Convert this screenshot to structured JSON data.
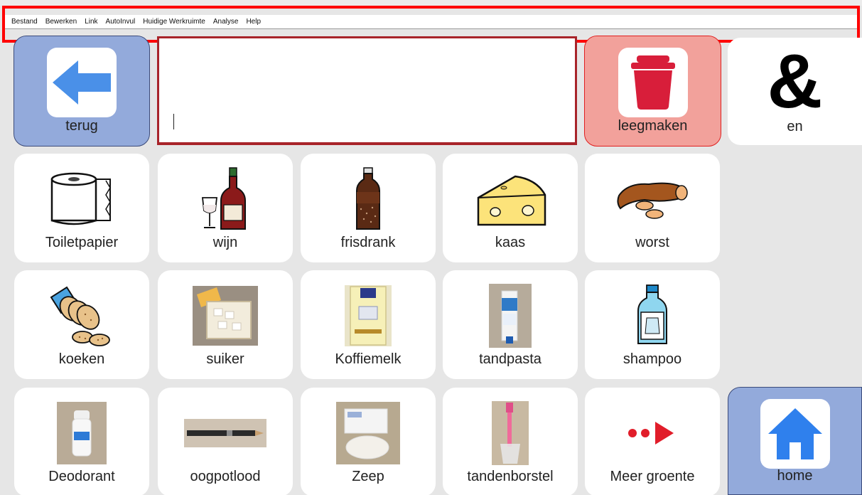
{
  "menu": {
    "items": [
      "Bestand",
      "Bewerken",
      "Link",
      "AutoInvul",
      "Huidige Werkruimte",
      "Analyse",
      "Help"
    ]
  },
  "toprow": {
    "back": {
      "label": "terug",
      "icon": "arrow-left-icon"
    },
    "clear": {
      "label": "leegmaken",
      "icon": "trash-icon"
    },
    "and": {
      "label": "en",
      "symbol": "&"
    }
  },
  "grid": {
    "row1": [
      {
        "label": "Toiletpapier",
        "icon": "toilet-paper-icon"
      },
      {
        "label": "wijn",
        "icon": "wine-icon"
      },
      {
        "label": "frisdrank",
        "icon": "soda-bottle-icon"
      },
      {
        "label": "kaas",
        "icon": "cheese-icon"
      },
      {
        "label": "worst",
        "icon": "sausage-icon"
      }
    ],
    "row2": [
      {
        "label": "koeken",
        "icon": "cookies-icon"
      },
      {
        "label": "suiker",
        "icon": "sugar-photo"
      },
      {
        "label": "Koffiemelk",
        "icon": "coffee-milk-photo"
      },
      {
        "label": "tandpasta",
        "icon": "toothpaste-photo"
      },
      {
        "label": "shampoo",
        "icon": "shampoo-icon"
      }
    ],
    "row3": [
      {
        "label": "Deodorant",
        "icon": "deodorant-photo"
      },
      {
        "label": "oogpotlood",
        "icon": "eye-pencil-photo"
      },
      {
        "label": "Zeep",
        "icon": "soap-photo"
      },
      {
        "label": "tandenborstel",
        "icon": "toothbrush-photo"
      },
      {
        "label": "Meer groente",
        "icon": "more-arrow-icon"
      }
    ],
    "home": {
      "label": "home",
      "icon": "house-icon"
    }
  },
  "colors": {
    "nav_blue": "#93aadb",
    "clear_red": "#f2a19b",
    "highlight": "#ff0000",
    "textarea_border": "#a8242a"
  }
}
